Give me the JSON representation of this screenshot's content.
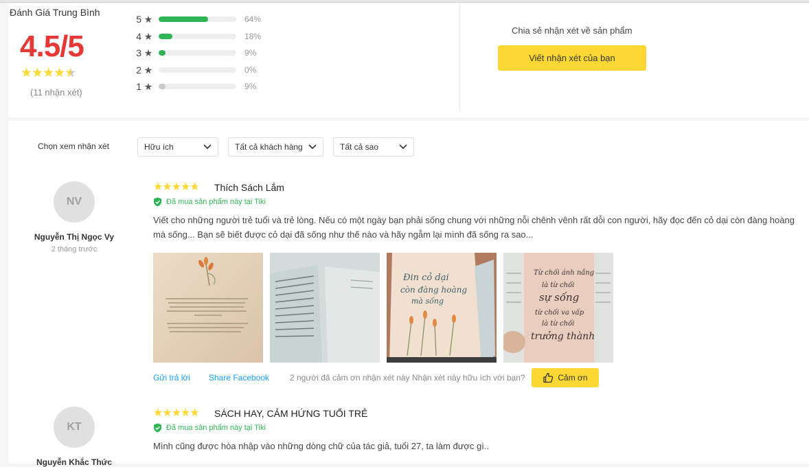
{
  "summary": {
    "title": "Đánh Giá Trung Bình",
    "score": "4.5/5",
    "stars": "★★★★★",
    "count_text": "(11 nhận xét)",
    "distribution": [
      {
        "label": "5",
        "percent_text": "64%",
        "fraction": 0.64
      },
      {
        "label": "4",
        "percent_text": "18%",
        "fraction": 0.18
      },
      {
        "label": "3",
        "percent_text": "9%",
        "fraction": 0.09
      },
      {
        "label": "2",
        "percent_text": "0%",
        "fraction": 0.0
      },
      {
        "label": "1",
        "percent_text": "9%",
        "fraction": 0.09
      }
    ],
    "share_text": "Chia sẻ nhận xét về sản phẩm",
    "write_button": "Viết nhận xét của bạn"
  },
  "filters": {
    "label": "Chọn xem nhận xét",
    "sort": "Hữu ích",
    "customers": "Tất cả khách hàng",
    "stars": "Tất cả sao"
  },
  "reviews": [
    {
      "initials": "NV",
      "author": "Nguyễn Thị Ngọc Vy",
      "time": "2 tháng trước",
      "stars": "★★★★★",
      "title": "Thích Sách Lắm",
      "verified": "Đã mua sản phẩm này tại Tiki",
      "body": "Viết cho những người trẻ tuổi và trẻ lòng. Nếu có một ngày bạn phải sống chung với những nỗi chênh vênh rất dỗi con người, hãy đọc đến cỏ dại còn đàng hoàng mà sống... Bạn sẽ biết được cỏ dại đã sống như thế nào và hãy ngẫm lại mình đã sống ra sao...",
      "reply": "Gửi trả lời",
      "share": "Share Facebook",
      "thanks_text": "2 người đã cảm ơn nhận xét này Nhận xét này hữu ích với bạn?",
      "thanks_button": "Cảm ơn"
    },
    {
      "initials": "KT",
      "author": "Nguyễn Khắc Thức",
      "stars": "★★★★★",
      "title": "SÁCH HAY, CẢM HỨNG TUỔI TRẺ",
      "verified": "Đã mua sản phẩm này tại Tiki",
      "body": "Mình cũng được hòa nhập vào những dòng chữ của tác giả, tuổi 27, ta làm được gì.."
    }
  ],
  "colors": {
    "accent_red": "#e53935",
    "star_yellow": "#fdd836",
    "bar_green": "#2fb455",
    "button_yellow": "#fdd835",
    "link_blue": "#189eff"
  }
}
